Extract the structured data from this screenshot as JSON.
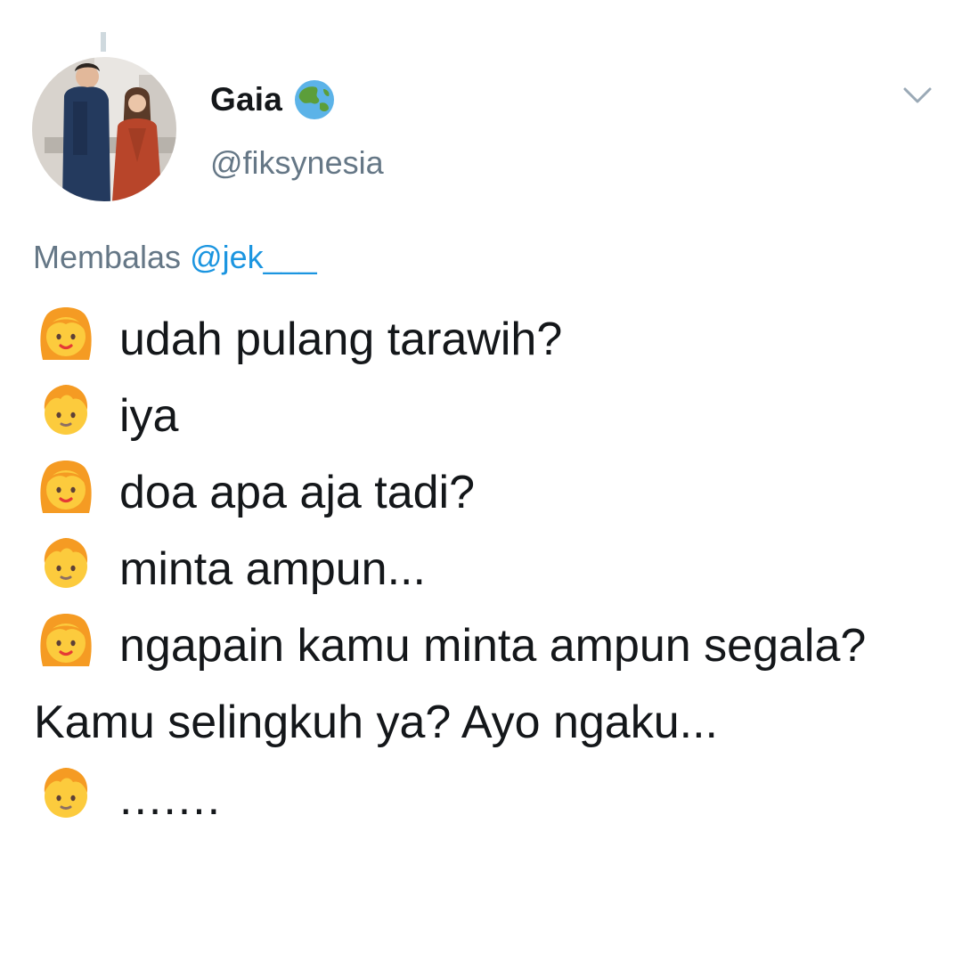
{
  "tweet": {
    "author": {
      "display_name": "Gaia",
      "badge_icon": "globe-asia-icon",
      "handle": "@fiksynesia"
    },
    "menu_icon": "chevron-down-icon",
    "reply": {
      "prefix": "Membalas",
      "mention": "@jek___"
    },
    "lines": [
      {
        "speaker_icon": "girl-emoji-icon",
        "text": "udah pulang tarawih?"
      },
      {
        "speaker_icon": "boy-emoji-icon",
        "text": "iya"
      },
      {
        "speaker_icon": "girl-emoji-icon",
        "text": "doa apa aja tadi?"
      },
      {
        "speaker_icon": "boy-emoji-icon",
        "text": "minta ampun..."
      },
      {
        "speaker_icon": "girl-emoji-icon",
        "text": "ngapain kamu minta ampun segala? Kamu selingkuh ya? Ayo ngaku..."
      },
      {
        "speaker_icon": "boy-emoji-icon",
        "text": "......."
      }
    ]
  },
  "colors": {
    "text_primary": "#14171a",
    "text_secondary": "#657786",
    "link": "#1b95e0",
    "emoji_yellow": "#fbc02d",
    "emoji_hair": "#f59b23"
  }
}
